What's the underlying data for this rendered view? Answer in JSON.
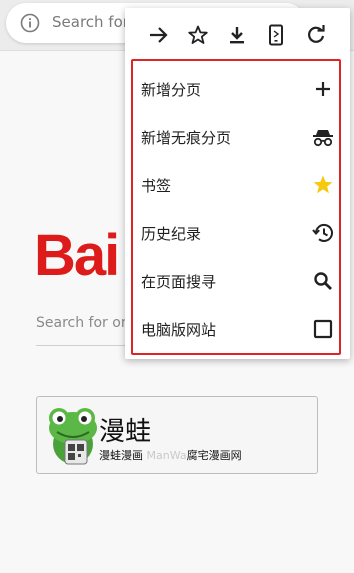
{
  "omnibox": {
    "placeholder": "Search for"
  },
  "baidu": {
    "logo_text": "Bai",
    "search_placeholder": "Search for or"
  },
  "promo": {
    "title": "漫蛙",
    "subtitle_prefix": "漫蛙漫画 ",
    "subtitle_faded": "ManWa",
    "subtitle_suffix": "腐宅漫画网"
  },
  "menu": {
    "toolbar": [
      {
        "icon": "forward-arrow-icon"
      },
      {
        "icon": "star-outline-icon"
      },
      {
        "icon": "download-icon"
      },
      {
        "icon": "desktop-site-phone-icon"
      },
      {
        "icon": "refresh-icon"
      }
    ],
    "items": [
      {
        "label": "新增分页",
        "icon": "plus-icon"
      },
      {
        "label": "新增无痕分页",
        "icon": "incognito-icon"
      },
      {
        "label": "书签",
        "icon": "star-filled-icon"
      },
      {
        "label": "历史纪录",
        "icon": "history-icon"
      },
      {
        "label": "在页面搜寻",
        "icon": "search-icon"
      },
      {
        "label": "电脑版网站",
        "icon": "checkbox-icon"
      }
    ]
  },
  "colors": {
    "highlight_border": "#e02424",
    "bookmark_star": "#f6c90e",
    "baidu_red": "#de1b1b"
  }
}
